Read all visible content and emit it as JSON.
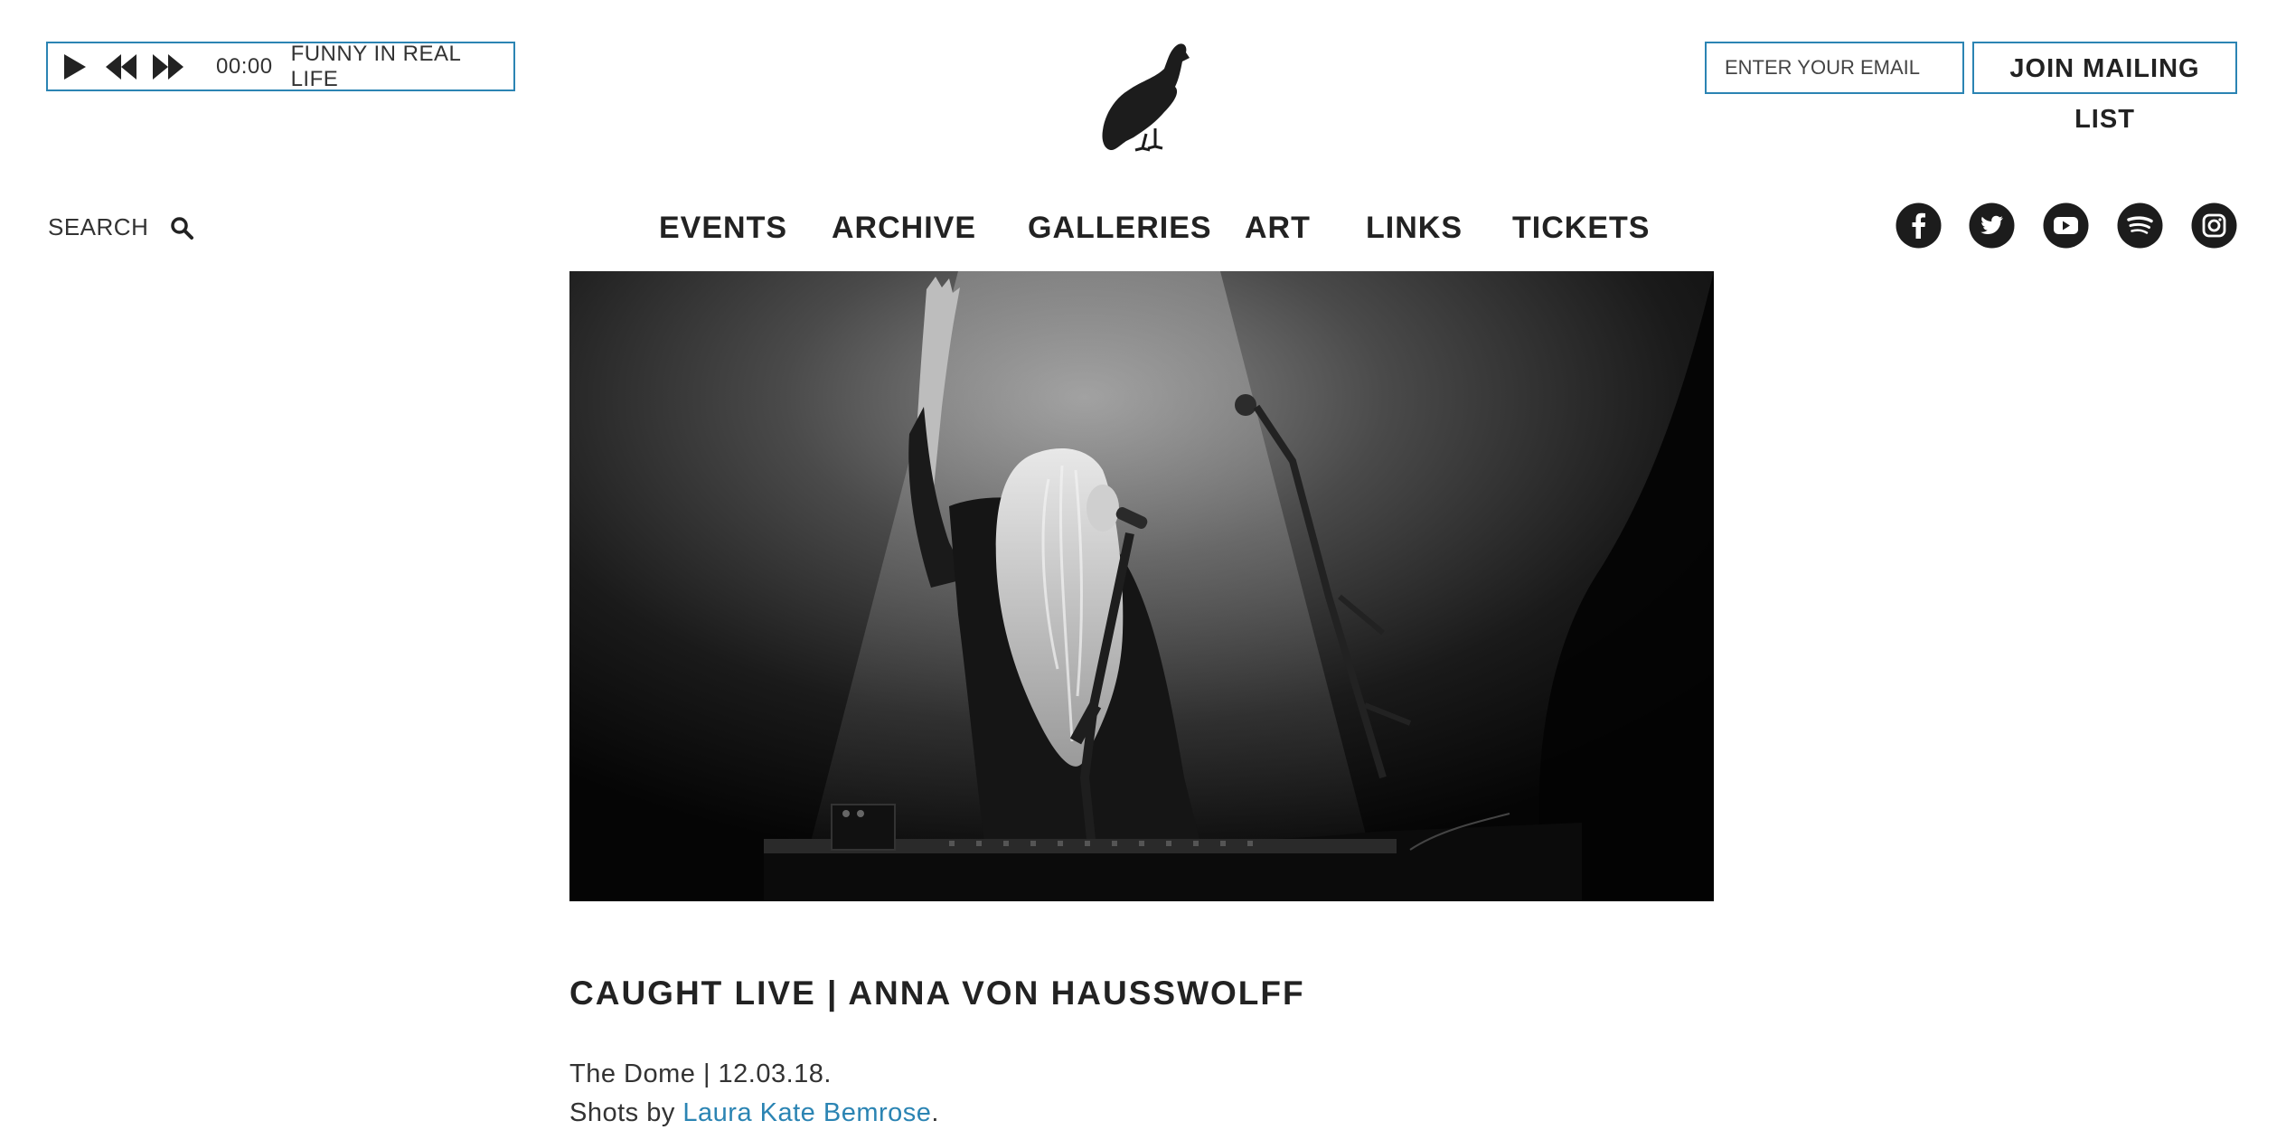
{
  "player": {
    "time": "00:00",
    "track": "FUNNY IN REAL LIFE",
    "play_icon": "play-icon",
    "rewind_icon": "rewind-icon",
    "forward_icon": "fast-forward-icon"
  },
  "logo": {
    "icon": "bird-logo-icon"
  },
  "mailing": {
    "email_placeholder": "ENTER YOUR EMAIL",
    "join_label_line1": "JOIN MAILING",
    "join_label_line2": "LIST"
  },
  "search": {
    "label": "SEARCH",
    "icon": "search-icon"
  },
  "nav": {
    "items": [
      {
        "label": "EVENTS"
      },
      {
        "label": "ARCHIVE"
      },
      {
        "label": "GALLERIES"
      },
      {
        "label": "ART"
      },
      {
        "label": "LINKS"
      },
      {
        "label": "TICKETS"
      }
    ]
  },
  "social": [
    "facebook-icon",
    "twitter-icon",
    "youtube-icon",
    "spotify-icon",
    "instagram-icon"
  ],
  "article": {
    "title": "CAUGHT LIVE | ANNA VON HAUSSWOLFF",
    "venue_date": "The Dome | 12.03.18.",
    "credit_prefix": "Shots by ",
    "credit_name": "Laura Kate Bemrose",
    "credit_suffix": "."
  },
  "colors": {
    "accent": "#2b84b3",
    "text": "#222222",
    "background": "#ffffff"
  }
}
